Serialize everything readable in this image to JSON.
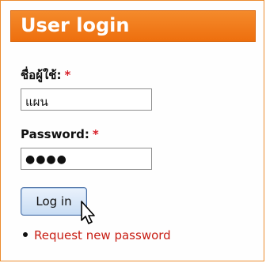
{
  "block": {
    "title": "User login"
  },
  "username": {
    "label": "ชื่อผู้ใช้:",
    "required_mark": "*",
    "value": "แผน"
  },
  "password": {
    "label": "Password:",
    "required_mark": "*",
    "value": "●●●●"
  },
  "login_button": {
    "label": "Log in"
  },
  "links": {
    "request_new_password": "Request new password"
  },
  "colors": {
    "header_bg": "#f07a1a",
    "link": "#c81e14",
    "required": "#d8202a"
  }
}
